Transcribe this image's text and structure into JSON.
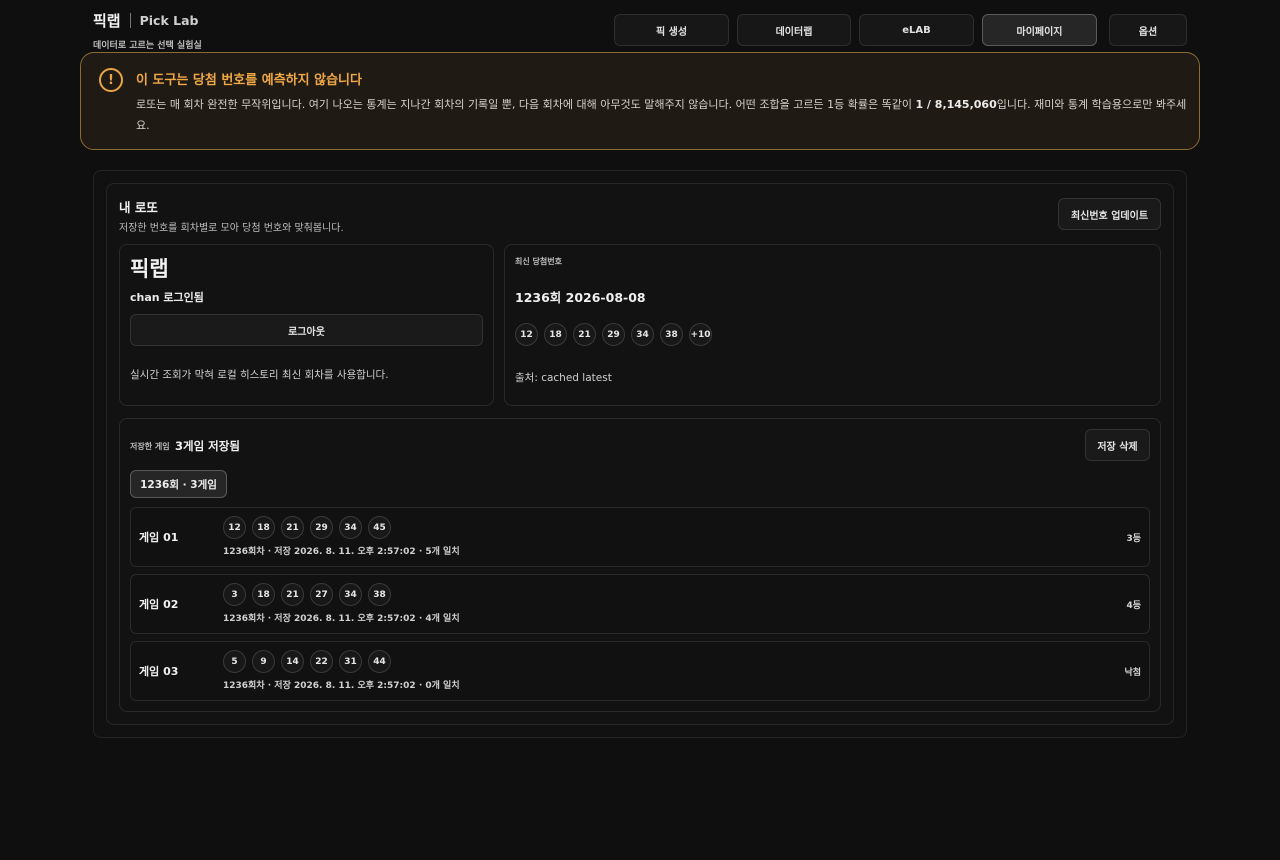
{
  "brand": {
    "name": "픽랩",
    "en": "Pick Lab",
    "tagline": "데이터로 고르는 선택 실험실"
  },
  "nav": [
    "픽 생성",
    "데이터랩",
    "eLAB",
    "마이페이지",
    "옵션"
  ],
  "warning": {
    "title": "이 도구는 당첨 번호를 예측하지 않습니다",
    "body_pre": "로또는 매 회차 완전한 무작위입니다. 여기 나오는 통계는 지나간 회차의 기록일 뿐, 다음 회차에 대해 아무것도 말해주지 않습니다. 어떤 조합을 고르든 1등 확률은 똑같이 ",
    "odds": "1 / 8,145,060",
    "body_post": "입니다. 재미와 통계 학습용으로만 봐주세요."
  },
  "section": {
    "title": "내 로또",
    "subtitle": "저장한 번호를 회차별로 모아 당첨 번호와 맞춰봅니다.",
    "update_button": "최신번호 업데이트"
  },
  "account": {
    "name": "픽랩",
    "user_line": "chan 로그인됨",
    "logout": "로그아웃",
    "note": "실시간 조회가 막혀 로컬 히스토리 최신 회차를 사용합니다."
  },
  "latest": {
    "label": "최신 당첨번호",
    "title": "1236회 2026-08-08",
    "numbers": [
      "12",
      "18",
      "21",
      "29",
      "34",
      "38",
      "+10"
    ],
    "source": "출처: cached latest"
  },
  "saved": {
    "label": "저장한 게임",
    "count": "3게임 저장됨",
    "delete_button": "저장 삭제",
    "round_chip": "1236회 · 3게임",
    "games": [
      {
        "name": "게임 01",
        "numbers": [
          "12",
          "18",
          "21",
          "29",
          "34",
          "45"
        ],
        "meta": "1236회차 · 저장 2026. 8. 11. 오후 2:57:02 · 5개 일치",
        "rank": "3등"
      },
      {
        "name": "게임 02",
        "numbers": [
          "3",
          "18",
          "21",
          "27",
          "34",
          "38"
        ],
        "meta": "1236회차 · 저장 2026. 8. 11. 오후 2:57:02 · 4개 일치",
        "rank": "4등"
      },
      {
        "name": "게임 03",
        "numbers": [
          "5",
          "9",
          "14",
          "22",
          "31",
          "44"
        ],
        "meta": "1236회차 · 저장 2026. 8. 11. 오후 2:57:02 · 0개 일치",
        "rank": "낙첨"
      }
    ]
  },
  "colors": {
    "accent": "#f0a847",
    "warning_border": "#8a6a35",
    "background": "#0f0f0f"
  },
  "icons": {
    "warning": "exclamation-circle-icon"
  }
}
